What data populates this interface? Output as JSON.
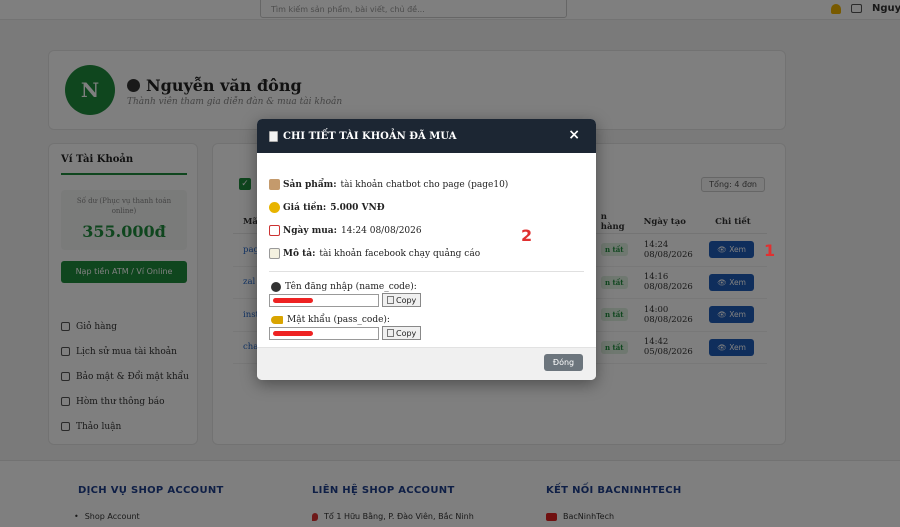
{
  "header": {
    "search_placeholder": "Tìm kiếm sản phẩm, bài viết, chủ đề...",
    "user_label": "Nguyễn"
  },
  "profile": {
    "avatar_letter": "N",
    "name": "Nguyễn văn đông",
    "subtitle": "Thành viên tham gia diễn đàn & mua tài khoản"
  },
  "sidebar": {
    "title": "Ví Tài Khoản",
    "balance_label": "Số dư (Phục vụ thanh toán online)",
    "balance": "355.000đ",
    "topup_label": "Nạp tiền ATM / Ví Online",
    "menu": [
      {
        "label": "Giỏ hàng",
        "icon": "cart-icon"
      },
      {
        "label": "Lịch sử mua tài khoản",
        "icon": "history-icon"
      },
      {
        "label": "Bảo mật & Đổi mật khẩu",
        "icon": "lock-icon"
      },
      {
        "label": "Hòm thư thông báo",
        "icon": "mailbox-icon"
      },
      {
        "label": "Thảo luận",
        "icon": "discussion-icon"
      }
    ]
  },
  "orders": {
    "total_label": "Tổng: 4 đơn",
    "columns": {
      "code": "Mã",
      "status": "n hàng",
      "created": "Ngày tạo",
      "detail": "Chi tiết"
    },
    "rows": [
      {
        "code": "pag",
        "status": "n tất",
        "created": "14:24 08/08/2026",
        "action": "Xem"
      },
      {
        "code": "zal",
        "status": "n tất",
        "created": "14:16 08/08/2026",
        "action": "Xem"
      },
      {
        "code": "inst",
        "status": "n tất",
        "created": "14:00 08/08/2026",
        "action": "Xem"
      },
      {
        "code": "cha",
        "status": "n tất",
        "created": "14:42 05/08/2026",
        "action": "Xem"
      }
    ],
    "annotation": "1"
  },
  "modal": {
    "title": "CHI TIẾT TÀI KHOẢN ĐÃ MUA",
    "close_symbol": "×",
    "product_label": "Sản phẩm:",
    "product_value": "tài khoản chatbot cho page (page10)",
    "price_label": "Giá tiền:",
    "price_value": "5.000 VNĐ",
    "date_label": "Ngày mua:",
    "date_value": "14:24 08/08/2026",
    "desc_label": "Mô tả:",
    "desc_value": "tài khoản facebook chạy quảng cáo",
    "username_label": "Tên đăng nhập (name_code):",
    "password_label": "Mật khẩu (pass_code):",
    "copy_label": "Copy",
    "close_button": "Đóng",
    "annotation": "2"
  },
  "footer": {
    "col1_title": "DỊCH VỤ SHOP ACCOUNT",
    "col1_item": "Shop Account",
    "col2_title": "LIÊN HỆ SHOP ACCOUNT",
    "col2_item": "Tổ 1 Hữu Bằng, P. Đào Viên, Bắc Ninh",
    "col3_title": "KẾT NỐI BACNINHTECH",
    "col3_item": "BacNinhTech"
  }
}
